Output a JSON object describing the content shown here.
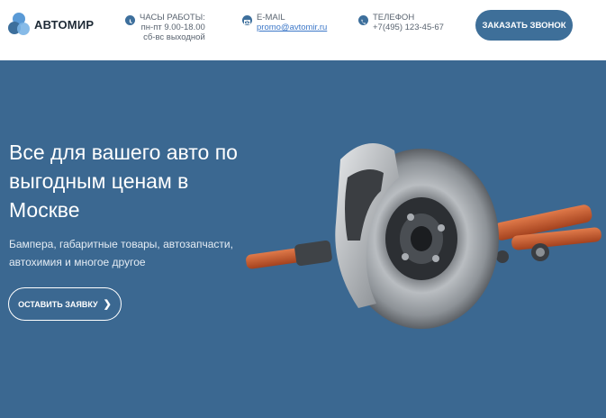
{
  "brand": {
    "name": "АВТОМИР"
  },
  "header": {
    "hours": {
      "label": "ЧАСЫ РАБОТЫ:",
      "line1": "пн-пт 9.00-18.00",
      "line2": "сб-вс выходной"
    },
    "email": {
      "label": "E-MAIL",
      "value": "promo@avtomir.ru"
    },
    "phone": {
      "label": "ТЕЛЕФОН",
      "value": "+7(495) 123-45-67"
    },
    "callback_label": "ЗАКАЗАТЬ ЗВОНОК"
  },
  "hero": {
    "title": "Все для вашего авто по выгодным ценам в Москве",
    "subtitle": "Бампера, габаритные товары, автозапчасти, автохимия и многое другое",
    "cta_label": "ОСТАВИТЬ ЗАЯВКУ",
    "cta_arrow": "❯"
  },
  "colors": {
    "accent": "#3e6f99",
    "hero_bg": "#3b6891",
    "link": "#3d78c8"
  }
}
